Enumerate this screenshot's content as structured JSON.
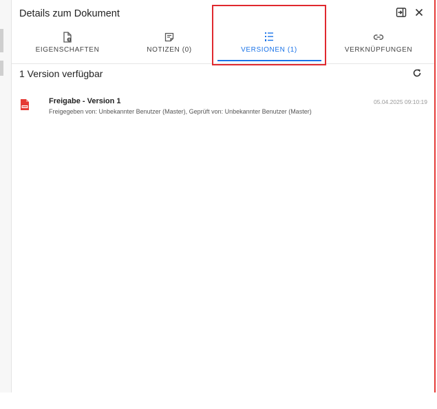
{
  "panel": {
    "title": "Details zum Dokument"
  },
  "header": {
    "collapse_icon": "collapse-right-icon",
    "close_icon": "close-icon"
  },
  "tabs": [
    {
      "label": "EIGENSCHAFTEN",
      "icon": "document-info-icon",
      "active": false
    },
    {
      "label": "NOTIZEN (0)",
      "icon": "note-icon",
      "active": false
    },
    {
      "label": "VERSIONEN (1)",
      "icon": "list-numbered-icon",
      "active": true
    },
    {
      "label": "VERKNÜPFUNGEN",
      "icon": "link-icon",
      "active": false
    }
  ],
  "versions": {
    "count_text": "1 Version verfügbar",
    "refresh_icon": "refresh-icon",
    "items": [
      {
        "title": "Freigabe - Version 1",
        "description": "Freigegeben von: Unbekannter Benutzer (Master), Geprüft von: Unbekannter Benutzer (Master)",
        "date": "05.04.2025 09:10:19",
        "icon": "pdf-file-icon"
      }
    ]
  },
  "colors": {
    "accent": "#1a73e8",
    "highlight": "#e0282e",
    "pdf": "#e53935"
  }
}
